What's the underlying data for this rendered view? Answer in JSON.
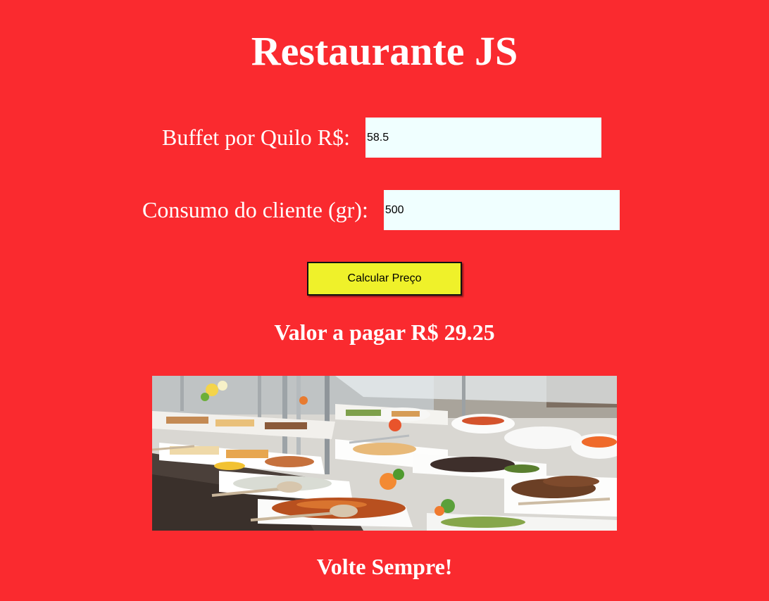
{
  "header": {
    "title": "Restaurante JS"
  },
  "form": {
    "price_label": "Buffet por Quilo R$:",
    "price_value": "58.5",
    "weight_label": "Consumo do cliente (gr):",
    "weight_value": "500",
    "calculate_label": "Calcular Preço"
  },
  "result": {
    "text": "Valor a pagar R$ 29.25"
  },
  "image": {
    "subject": "buffet-food-photo"
  },
  "footer": {
    "text": "Volte Sempre!"
  },
  "colors": {
    "background": "#fa2a2f",
    "input_background": "#f0ffff",
    "button_background": "#eff12a",
    "text": "#ffffff"
  }
}
